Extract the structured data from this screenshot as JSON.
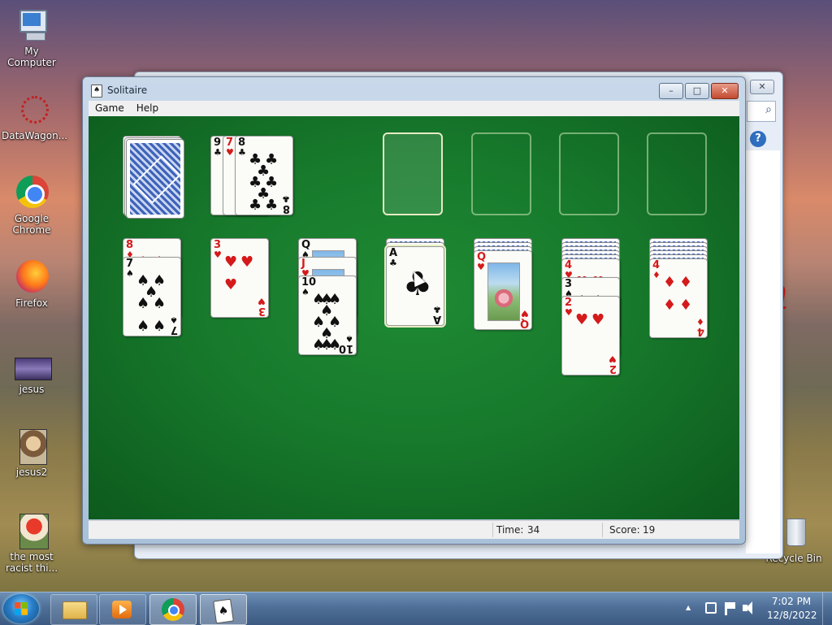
{
  "desktop": {
    "icons": [
      {
        "label": "My Computer"
      },
      {
        "label": "DataWagon..."
      },
      {
        "label": "Google Chrome"
      },
      {
        "label": "Firefox"
      },
      {
        "label": "jesus"
      },
      {
        "label": "jesus2"
      },
      {
        "label": "the most racist thi..."
      },
      {
        "label": "Recycle Bin"
      }
    ]
  },
  "window": {
    "title": "Solitaire",
    "controls": {
      "minimize": "–",
      "maximize": "□",
      "close": "✕"
    },
    "menu": [
      "Game",
      "Help"
    ],
    "status": {
      "time_label": "Time:",
      "time_value": "34",
      "score_label": "Score:",
      "score_value": "19"
    }
  },
  "back_window": {
    "close": "✕",
    "help": "?"
  },
  "game": {
    "waste": [
      {
        "rank": "9",
        "suit": "♣",
        "color": "black"
      },
      {
        "rank": "7",
        "suit": "♥",
        "color": "red"
      },
      {
        "rank": "8",
        "suit": "♣",
        "color": "black"
      }
    ],
    "tableau": [
      {
        "hidden": 0,
        "cards": [
          {
            "rank": "8",
            "suit": "♦"
          },
          {
            "rank": "7",
            "suit": "♠"
          }
        ]
      },
      {
        "hidden": 0,
        "cards": [
          {
            "rank": "3",
            "suit": "♥"
          }
        ]
      },
      {
        "hidden": 0,
        "cards": [
          {
            "rank": "Q",
            "suit": "♠"
          },
          {
            "rank": "J",
            "suit": "♥"
          },
          {
            "rank": "10",
            "suit": "♠"
          }
        ]
      },
      {
        "hidden": 2,
        "cards": [
          {
            "rank": "A",
            "suit": "♣"
          }
        ]
      },
      {
        "hidden": 3,
        "cards": [
          {
            "rank": "Q",
            "suit": "♥"
          }
        ]
      },
      {
        "hidden": 5,
        "cards": [
          {
            "rank": "4",
            "suit": "♥"
          },
          {
            "rank": "3",
            "suit": "♠"
          },
          {
            "rank": "2",
            "suit": "♥"
          }
        ]
      },
      {
        "hidden": 5,
        "cards": [
          {
            "rank": "4",
            "suit": "♦"
          }
        ]
      }
    ]
  },
  "taskbar": {
    "clock_time": "7:02 PM",
    "clock_date": "12/8/2022",
    "tray_arrow": "▲"
  },
  "colors": {
    "felt": "#177a2c",
    "red_suit": "#d41a1a",
    "taskbar": "#4f6f98"
  }
}
